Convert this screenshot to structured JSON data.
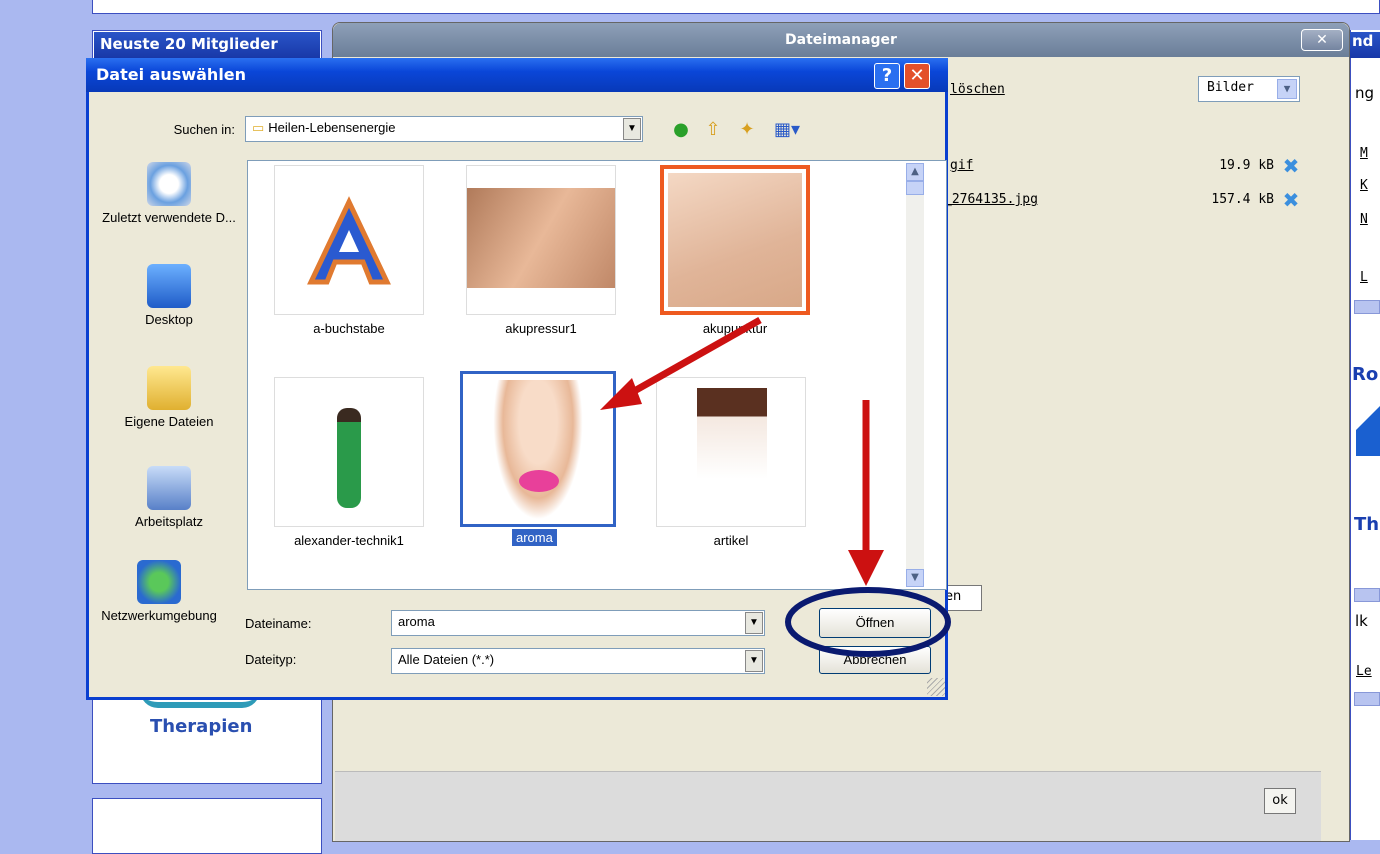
{
  "site": {
    "members_header": "Neuste 20 Mitglieder",
    "therapien": "Therapien",
    "right_col": {
      "head": "nd",
      "items": [
        "ng",
        "M",
        "K",
        "N",
        "L",
        "Ro",
        "Th",
        "lk",
        "Le"
      ]
    }
  },
  "dateimanager": {
    "title": "Dateimanager",
    "close_label": "✕",
    "delete_link": "löschen",
    "filter_value": "Bilder",
    "files": [
      {
        "name": "gif",
        "size": "19.9 kB"
      },
      {
        "name": "_2764135.jpg",
        "size": "157.4 kB"
      }
    ],
    "partial_input": "en",
    "ok_label": "ok"
  },
  "dialog": {
    "title": "Datei auswählen",
    "help_label": "?",
    "close_label": "✕",
    "lookin_label": "Suchen in:",
    "lookin_value": "Heilen-Lebensenergie",
    "places": [
      {
        "label": "Zuletzt verwendete D..."
      },
      {
        "label": "Desktop"
      },
      {
        "label": "Eigene Dateien"
      },
      {
        "label": "Arbeitsplatz"
      },
      {
        "label": "Netzwerkumgebung"
      }
    ],
    "files": [
      {
        "label": "a-buchstabe"
      },
      {
        "label": "akupressur1"
      },
      {
        "label": "akupunktur"
      },
      {
        "label": "alexander-technik1"
      },
      {
        "label": "aroma"
      },
      {
        "label": "artikel"
      }
    ],
    "filename_label": "Dateiname:",
    "filename_value": "aroma",
    "filetype_label": "Dateityp:",
    "filetype_value": "Alle Dateien (*.*)",
    "open_label": "Öffnen",
    "cancel_label": "Abbrechen"
  },
  "colors": {
    "annotation_arrow": "#cc1111",
    "annotation_circle": "#0a1a70",
    "selection": "#3163c5"
  }
}
